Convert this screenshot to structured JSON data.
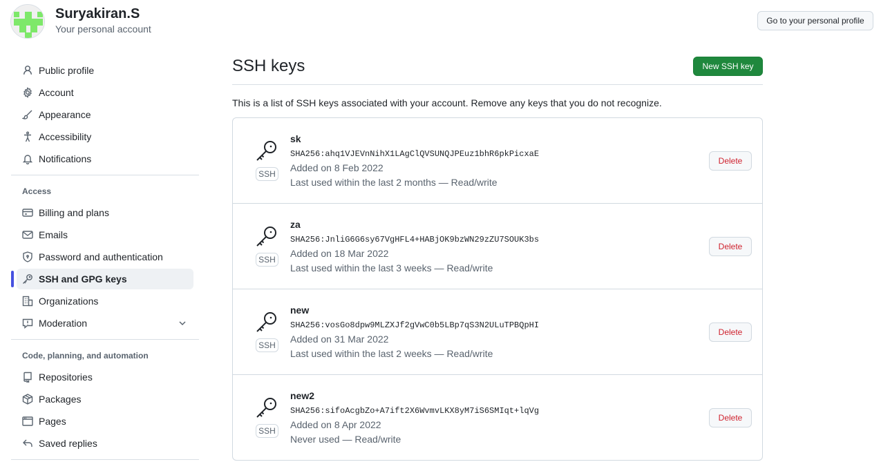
{
  "header": {
    "user_name": "Suryakiran.S",
    "account_type": "Your personal account",
    "profile_button": "Go to your personal profile"
  },
  "sidebar": {
    "items": [
      {
        "label": "Public profile",
        "icon": "person-icon"
      },
      {
        "label": "Account",
        "icon": "gear-icon"
      },
      {
        "label": "Appearance",
        "icon": "paintbrush-icon"
      },
      {
        "label": "Accessibility",
        "icon": "accessibility-icon"
      },
      {
        "label": "Notifications",
        "icon": "bell-icon"
      }
    ],
    "access_heading": "Access",
    "access_items": [
      {
        "label": "Billing and plans",
        "icon": "credit-card-icon"
      },
      {
        "label": "Emails",
        "icon": "mail-icon"
      },
      {
        "label": "Password and authentication",
        "icon": "shield-lock-icon"
      },
      {
        "label": "SSH and GPG keys",
        "icon": "key-icon",
        "active": true
      },
      {
        "label": "Organizations",
        "icon": "organization-icon"
      },
      {
        "label": "Moderation",
        "icon": "report-icon"
      }
    ],
    "code_heading": "Code, planning, and automation",
    "code_items": [
      {
        "label": "Repositories",
        "icon": "repo-icon"
      },
      {
        "label": "Packages",
        "icon": "package-icon"
      },
      {
        "label": "Pages",
        "icon": "browser-icon"
      },
      {
        "label": "Saved replies",
        "icon": "reply-icon"
      }
    ]
  },
  "main": {
    "title": "SSH keys",
    "new_key_button": "New SSH key",
    "description": "This is a list of SSH keys associated with your account. Remove any keys that you do not recognize.",
    "keys": [
      {
        "title": "sk",
        "badge": "SSH",
        "fingerprint": "SHA256:ahq1VJEVnNihX1LAgClQVSUNQJPEuz1bhR6pkPicxaE",
        "added": "Added on 8 Feb 2022",
        "used": "Last used within the last 2 months — Read/write",
        "delete": "Delete"
      },
      {
        "title": "za",
        "badge": "SSH",
        "fingerprint": "SHA256:JnliG6G6sy67VgHFL4+HABjOK9bzWN29zZU7SOUK3bs",
        "added": "Added on 18 Mar 2022",
        "used": "Last used within the last 3 weeks — Read/write",
        "delete": "Delete"
      },
      {
        "title": "new",
        "badge": "SSH",
        "fingerprint": "SHA256:vosGo8dpw9MLZXJf2gVwC0b5LBp7qS3N2ULuTPBQpHI",
        "added": "Added on 31 Mar 2022",
        "used": "Last used within the last 2 weeks — Read/write",
        "delete": "Delete"
      },
      {
        "title": "new2",
        "badge": "SSH",
        "fingerprint": "SHA256:sifoAcgbZo+A7ift2X6WvmvLKX8yM7iS6SMIqt+lqVg",
        "added": "Added on 8 Apr 2022",
        "used": "Never used — Read/write",
        "delete": "Delete"
      }
    ]
  },
  "colors": {
    "accent": "#1f883d",
    "active_indicator": "#4651e0",
    "danger": "#cf222e",
    "avatar": "#7ee86a"
  }
}
